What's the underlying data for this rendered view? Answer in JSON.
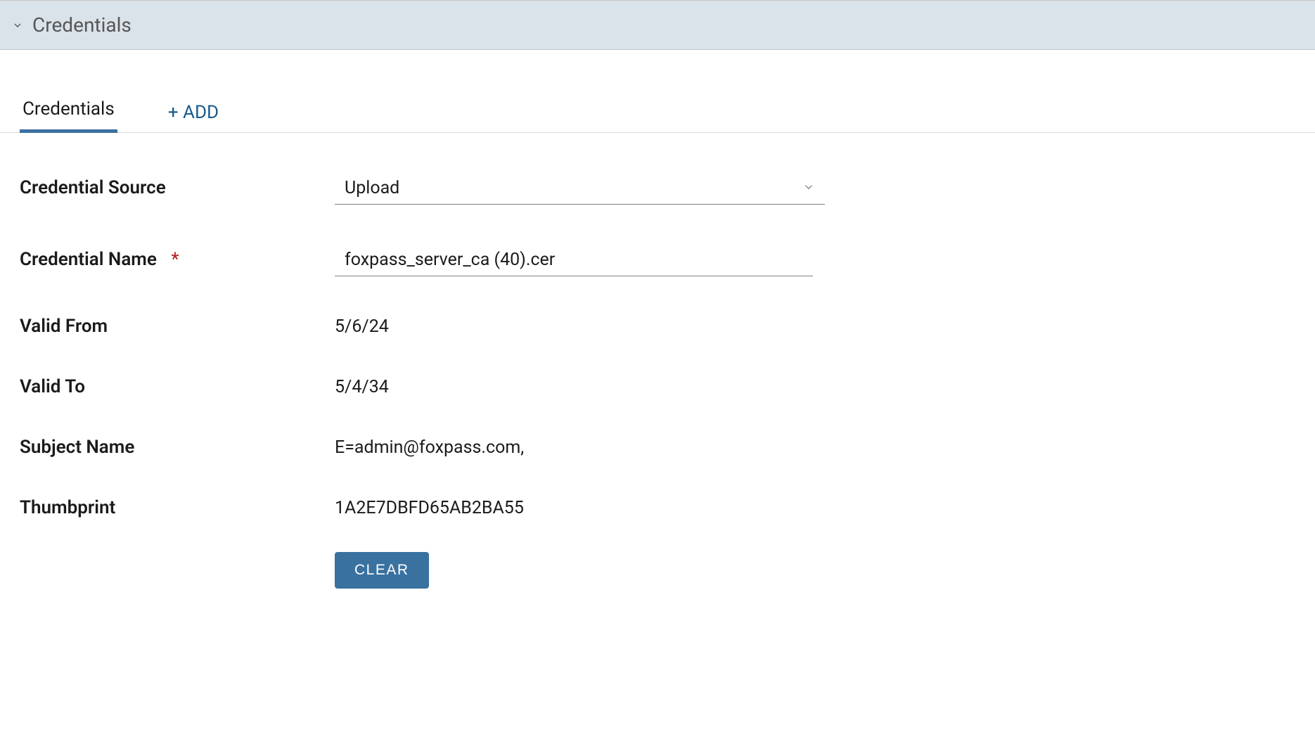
{
  "section": {
    "title": "Credentials"
  },
  "tabs": {
    "credentials_label": "Credentials",
    "add_label": "+ ADD"
  },
  "form": {
    "credential_source": {
      "label": "Credential Source",
      "value": "Upload"
    },
    "credential_name": {
      "label": "Credential Name",
      "required_marker": "*",
      "value": "foxpass_server_ca (40).cer"
    },
    "valid_from": {
      "label": "Valid From",
      "value": "5/6/24"
    },
    "valid_to": {
      "label": "Valid To",
      "value": "5/4/34"
    },
    "subject_name": {
      "label": "Subject Name",
      "value": "E=admin@foxpass.com,"
    },
    "thumbprint": {
      "label": "Thumbprint",
      "value": "1A2E7DBFD65AB2BA55"
    },
    "clear_button": "CLEAR"
  }
}
